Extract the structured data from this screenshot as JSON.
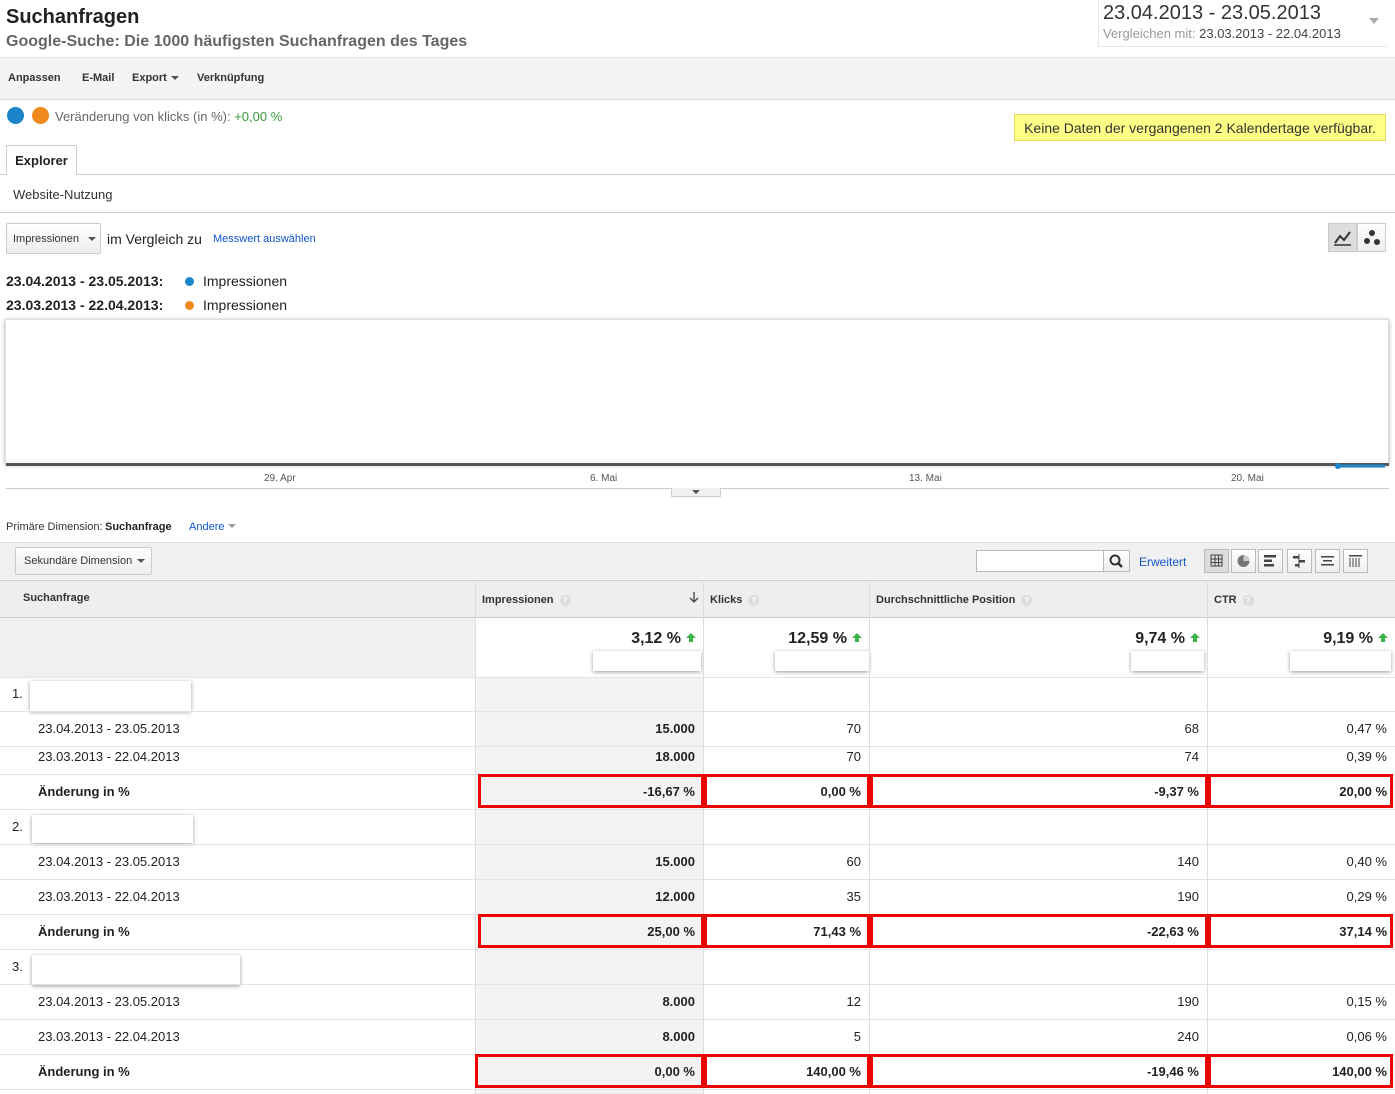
{
  "header": {
    "title": "Suchanfragen",
    "subtitle": "Google-Suche: Die 1000 häufigsten Suchanfragen des Tages",
    "date_range": "23.04.2013 - 23.05.2013",
    "compare_label": "Vergleichen mit:",
    "compare_range": "23.03.2013 - 22.04.2013"
  },
  "toolbar": {
    "customize": "Anpassen",
    "email": "E-Mail",
    "export": "Export",
    "shortcut": "Verknüpfung"
  },
  "segment": {
    "label": "Veränderung von klicks (in %):",
    "value": "+0,00 %",
    "colors": {
      "current": "#1a86c9",
      "previous": "#f08a1d"
    }
  },
  "notice": "Keine Daten der vergangenen 2 Kalendertage verfügbar.",
  "tabs": {
    "explorer": "Explorer",
    "subtab": "Website-Nutzung"
  },
  "metric": {
    "selected": "Impressionen",
    "compare_text": "im Vergleich zu",
    "select_link": "Messwert auswählen"
  },
  "legend": [
    {
      "range": "23.04.2013 - 23.05.2013:",
      "label": "Impressionen",
      "color": "#1a86c9"
    },
    {
      "range": "23.03.2013 - 22.04.2013:",
      "label": "Impressionen",
      "color": "#f08a1d"
    }
  ],
  "chart_data": {
    "type": "line",
    "x_ticks": [
      "29. Apr",
      "6. Mai",
      "13. Mai",
      "20. Mai"
    ],
    "series": [
      {
        "name": "Impressionen",
        "color": "#1a86c9"
      },
      {
        "name": "Impressionen",
        "color": "#f08a1d"
      }
    ]
  },
  "dimension": {
    "label": "Primäre Dimension:",
    "active": "Suchanfrage",
    "other": "Andere"
  },
  "controls": {
    "secondary": "Sekundäre Dimension",
    "advanced": "Erweitert",
    "view_icons": [
      "table-view-icon",
      "pie-view-icon",
      "performance-view-icon",
      "comparison-view-icon",
      "term-cloud-icon",
      "pivot-view-icon"
    ]
  },
  "table": {
    "columns": [
      "Suchanfrage",
      "Impressionen",
      "Klicks",
      "Durchschnittliche Position",
      "CTR"
    ],
    "help": "?",
    "totals": [
      "3,12 %",
      "12,59 %",
      "9,74 %",
      "9,19 %"
    ],
    "groups": [
      {
        "rank": "1.",
        "rows": [
          {
            "label": "23.04.2013 - 23.05.2013",
            "values": [
              "15.000",
              "70",
              "68",
              "0,47 %"
            ]
          },
          {
            "label": "23.03.2013 - 22.04.2013",
            "values": [
              "18.000",
              "70",
              "74",
              "0,39 %"
            ]
          },
          {
            "label": "Änderung in %",
            "values": [
              "-16,67 %",
              "0,00 %",
              "-9,37 %",
              "20,00 %"
            ]
          }
        ]
      },
      {
        "rank": "2.",
        "rows": [
          {
            "label": "23.04.2013 - 23.05.2013",
            "values": [
              "15.000",
              "60",
              "140",
              "0,40 %"
            ]
          },
          {
            "label": "23.03.2013 - 22.04.2013",
            "values": [
              "12.000",
              "35",
              "190",
              "0,29 %"
            ]
          },
          {
            "label": "Änderung in %",
            "values": [
              "25,00 %",
              "71,43 %",
              "-22,63 %",
              "37,14 %"
            ]
          }
        ]
      },
      {
        "rank": "3.",
        "rows": [
          {
            "label": "23.04.2013 - 23.05.2013",
            "values": [
              "8.000",
              "12",
              "190",
              "0,15 %"
            ]
          },
          {
            "label": "23.03.2013 - 22.04.2013",
            "values": [
              "8.000",
              "5",
              "240",
              "0,06 %"
            ]
          },
          {
            "label": "Änderung in %",
            "values": [
              "0,00 %",
              "140,00 %",
              "-19,46 %",
              "140,00 %"
            ]
          }
        ]
      }
    ]
  }
}
